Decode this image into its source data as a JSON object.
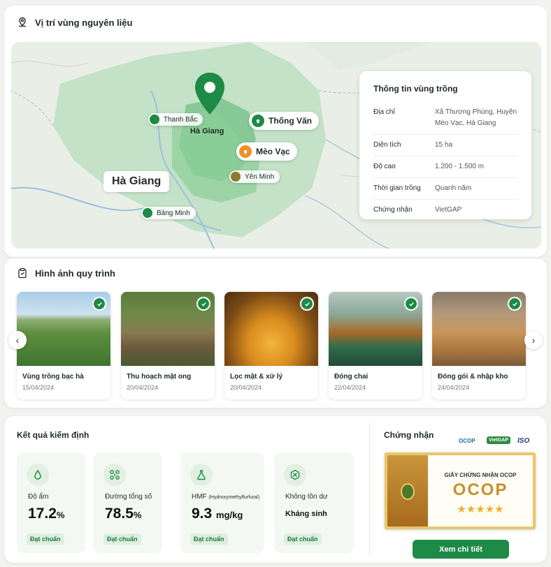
{
  "location": {
    "title": "Vị trí vùng nguyên liệu",
    "map": {
      "province": "Hà Giang",
      "center_label": "Hà Giang",
      "pins": [
        {
          "label": "Thống Văn",
          "color": "#1d8a45"
        },
        {
          "label": "Mèo Vạc",
          "color": "#f0902a"
        },
        {
          "label": "Yên Minh",
          "color": "#8a7a2a"
        },
        {
          "label": "Thanh Bắc",
          "color": "#1d8a45"
        },
        {
          "label": "Bảng Minh",
          "color": "#1d8a45"
        }
      ]
    },
    "info": {
      "title": "Thông tin vùng trồng",
      "rows": [
        {
          "key": "Địa chỉ",
          "value": "Xã Thượng Phùng, Huyện Mèo Vạc, Hà Giang"
        },
        {
          "key": "Diện tích",
          "value": "15 ha"
        },
        {
          "key": "Độ cao",
          "value": "1.200 - 1.500 m"
        },
        {
          "key": "Thời gian trồng",
          "value": "Quanh năm"
        },
        {
          "key": "Chứng nhận",
          "value": "VietGAP"
        }
      ]
    }
  },
  "process": {
    "title": "Hình ảnh quy trình",
    "steps": [
      {
        "title": "Vùng trồng bạc hà",
        "date": "15/04/2024"
      },
      {
        "title": "Thu hoạch mật ong",
        "date": "20/04/2024"
      },
      {
        "title": "Lọc mật & xử lý",
        "date": "20/04/2024"
      },
      {
        "title": "Đóng chai",
        "date": "22/04/2024"
      },
      {
        "title": "Đóng gói & nhập kho",
        "date": "24/04/2024"
      }
    ]
  },
  "tests": {
    "title": "Kết quả kiểm định",
    "items": [
      {
        "label": "Độ ẩm",
        "value": "17.2",
        "unit": "%",
        "status": "Đạt chuẩn"
      },
      {
        "label": "Đường tổng số",
        "value": "78.5",
        "unit": "%",
        "status": "Đạt chuẩn"
      },
      {
        "label": "HMF",
        "label_small": "(Hydroxymethylfurfural)",
        "value": "9.3",
        "unit": "mg/kg",
        "status": "Đạt chuẩn"
      },
      {
        "label": "Không tồn dư",
        "value": "Kháng sinh",
        "unit": "",
        "status": "Đạt chuẩn"
      }
    ]
  },
  "certs": {
    "title": "Chứng nhận",
    "logos": [
      "OCOP",
      "VietGAP",
      "ISO"
    ],
    "certificate": {
      "heading": "GIẤY CHỨNG NHẬN OCOP",
      "brand": "OCOP",
      "stars": "★★★★★"
    },
    "button": "Xem chi tiết"
  },
  "colors": {
    "accent": "#1d8a45",
    "badge_bg": "#dfeee0"
  }
}
